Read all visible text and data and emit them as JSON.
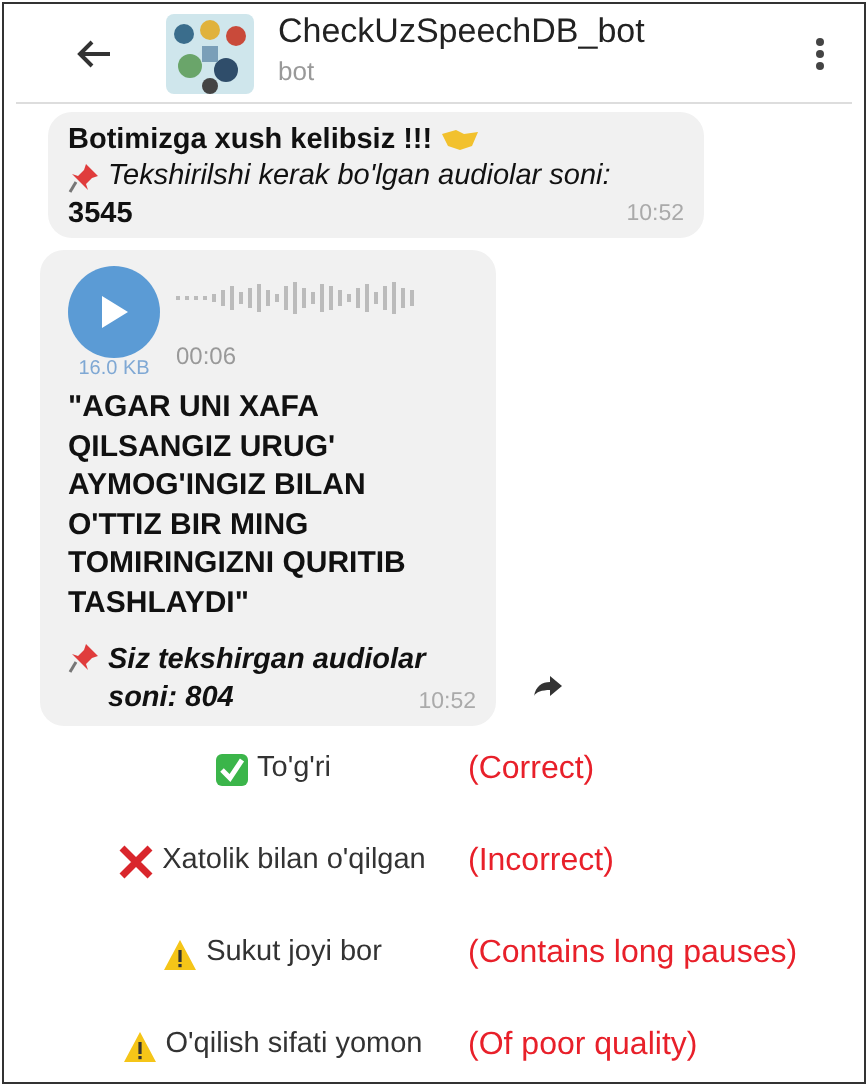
{
  "header": {
    "title": "CheckUzSpeechDB_bot",
    "subtitle": "bot"
  },
  "messages": [
    {
      "kind": "text",
      "title": "Botimizga xush kelibsiz !!!",
      "note": "Tekshirilshi kerak bo'lgan audiolar soni:",
      "count": "3545",
      "time": "10:52"
    },
    {
      "kind": "voice",
      "duration": "00:06",
      "size": "16.0 KB",
      "quote": "\"AGAR UNI XAFA\nQILSANGIZ  URUG'\nAYMOG'INGIZ BILAN\nO'TTIZ BIR MING\nTOMIRINGIZNI QURITIB\nTASHLAYDI\"",
      "note": "Siz tekshirgan audiolar\nsoni: 804",
      "time": "10:52"
    }
  ],
  "buttons": [
    {
      "kind": "check",
      "label": "To'g'ri",
      "translation": "(Correct)"
    },
    {
      "kind": "cross",
      "label": "Xatolik bilan o'qilgan",
      "translation": "(Incorrect)"
    },
    {
      "kind": "warning",
      "label": "Sukut joyi bor",
      "translation": "(Contains long pauses)"
    },
    {
      "kind": "warning",
      "label": "O'qilish sifati yomon",
      "translation": "(Of poor quality)"
    }
  ]
}
